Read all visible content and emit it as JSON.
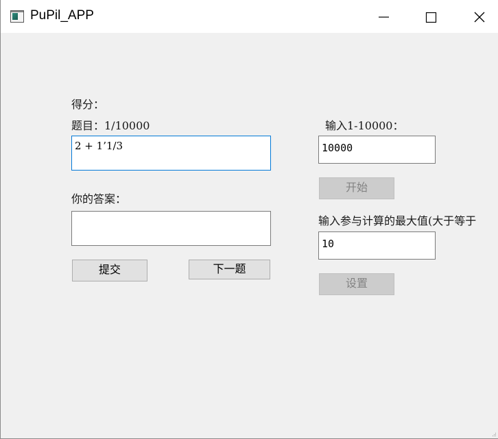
{
  "window": {
    "title": "PuPil_APP"
  },
  "quiz": {
    "score_label": "得分：",
    "question_label": "题目：1/10000",
    "question_text": "2 + 1’1/3",
    "answer_label": "你的答案：",
    "answer_value": "",
    "submit_label": "提交",
    "next_label": "下一题"
  },
  "settings": {
    "count_label": "输入1-10000：",
    "count_value": "10000",
    "start_label": "开始",
    "max_label": "输入参与计算的最大值(大于等于",
    "max_value": "10",
    "set_label": "设置"
  },
  "icons": {
    "app": "app-window-icon",
    "minimize": "minimize-icon",
    "maximize": "maximize-icon",
    "close": "close-icon"
  }
}
